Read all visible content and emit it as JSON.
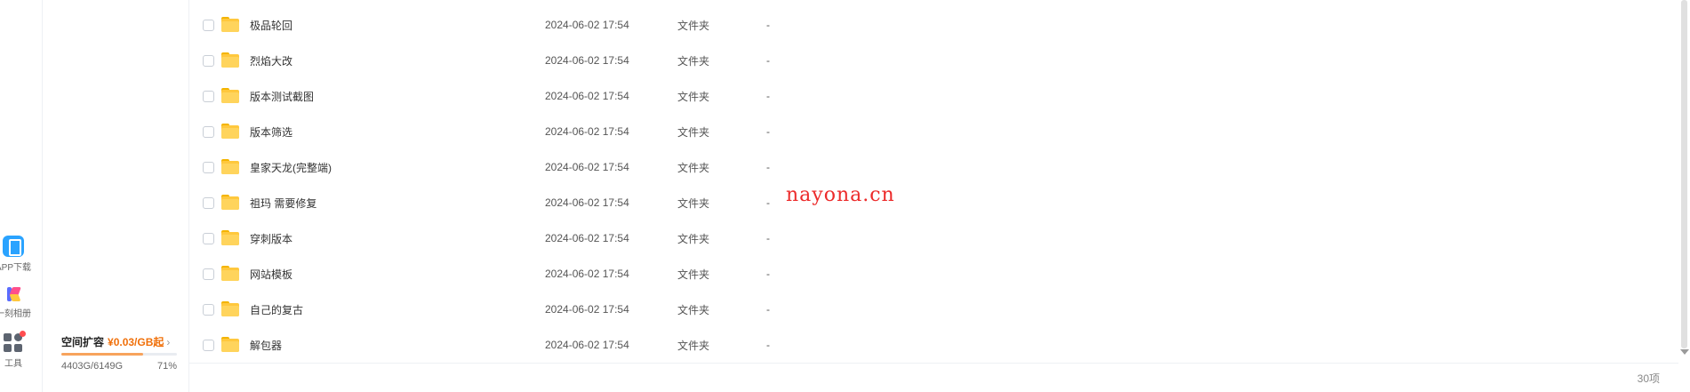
{
  "rail": {
    "items": [
      {
        "label": "APP下载",
        "icon": "phone-icon"
      },
      {
        "label": "一刻相册",
        "icon": "album-icon"
      },
      {
        "label": "工具",
        "icon": "tools-grid-icon"
      }
    ]
  },
  "quota": {
    "title": "空间扩容",
    "price": "¥0.03/GB起",
    "arrow": "›",
    "used": "4403G/6149G",
    "percent": "71%",
    "percent_value": 71,
    "accent_color": "#f0700a"
  },
  "files": [
    {
      "name": "极品轮回",
      "date": "2024-06-02 17:54",
      "type": "文件夹",
      "size": "-"
    },
    {
      "name": "烈焰大改",
      "date": "2024-06-02 17:54",
      "type": "文件夹",
      "size": "-"
    },
    {
      "name": "版本测试截图",
      "date": "2024-06-02 17:54",
      "type": "文件夹",
      "size": "-"
    },
    {
      "name": "版本筛选",
      "date": "2024-06-02 17:54",
      "type": "文件夹",
      "size": "-"
    },
    {
      "name": "皇家天龙(完整端)",
      "date": "2024-06-02 17:54",
      "type": "文件夹",
      "size": "-"
    },
    {
      "name": "祖玛 需要修复",
      "date": "2024-06-02 17:54",
      "type": "文件夹",
      "size": "-"
    },
    {
      "name": "穿刺版本",
      "date": "2024-06-02 17:54",
      "type": "文件夹",
      "size": "-"
    },
    {
      "name": "网站模板",
      "date": "2024-06-02 17:54",
      "type": "文件夹",
      "size": "-"
    },
    {
      "name": "自己的复古",
      "date": "2024-06-02 17:54",
      "type": "文件夹",
      "size": "-"
    },
    {
      "name": "解包器",
      "date": "2024-06-02 17:54",
      "type": "文件夹",
      "size": "-"
    }
  ],
  "footer": {
    "count": "30项"
  },
  "watermark": "nayona.cn"
}
